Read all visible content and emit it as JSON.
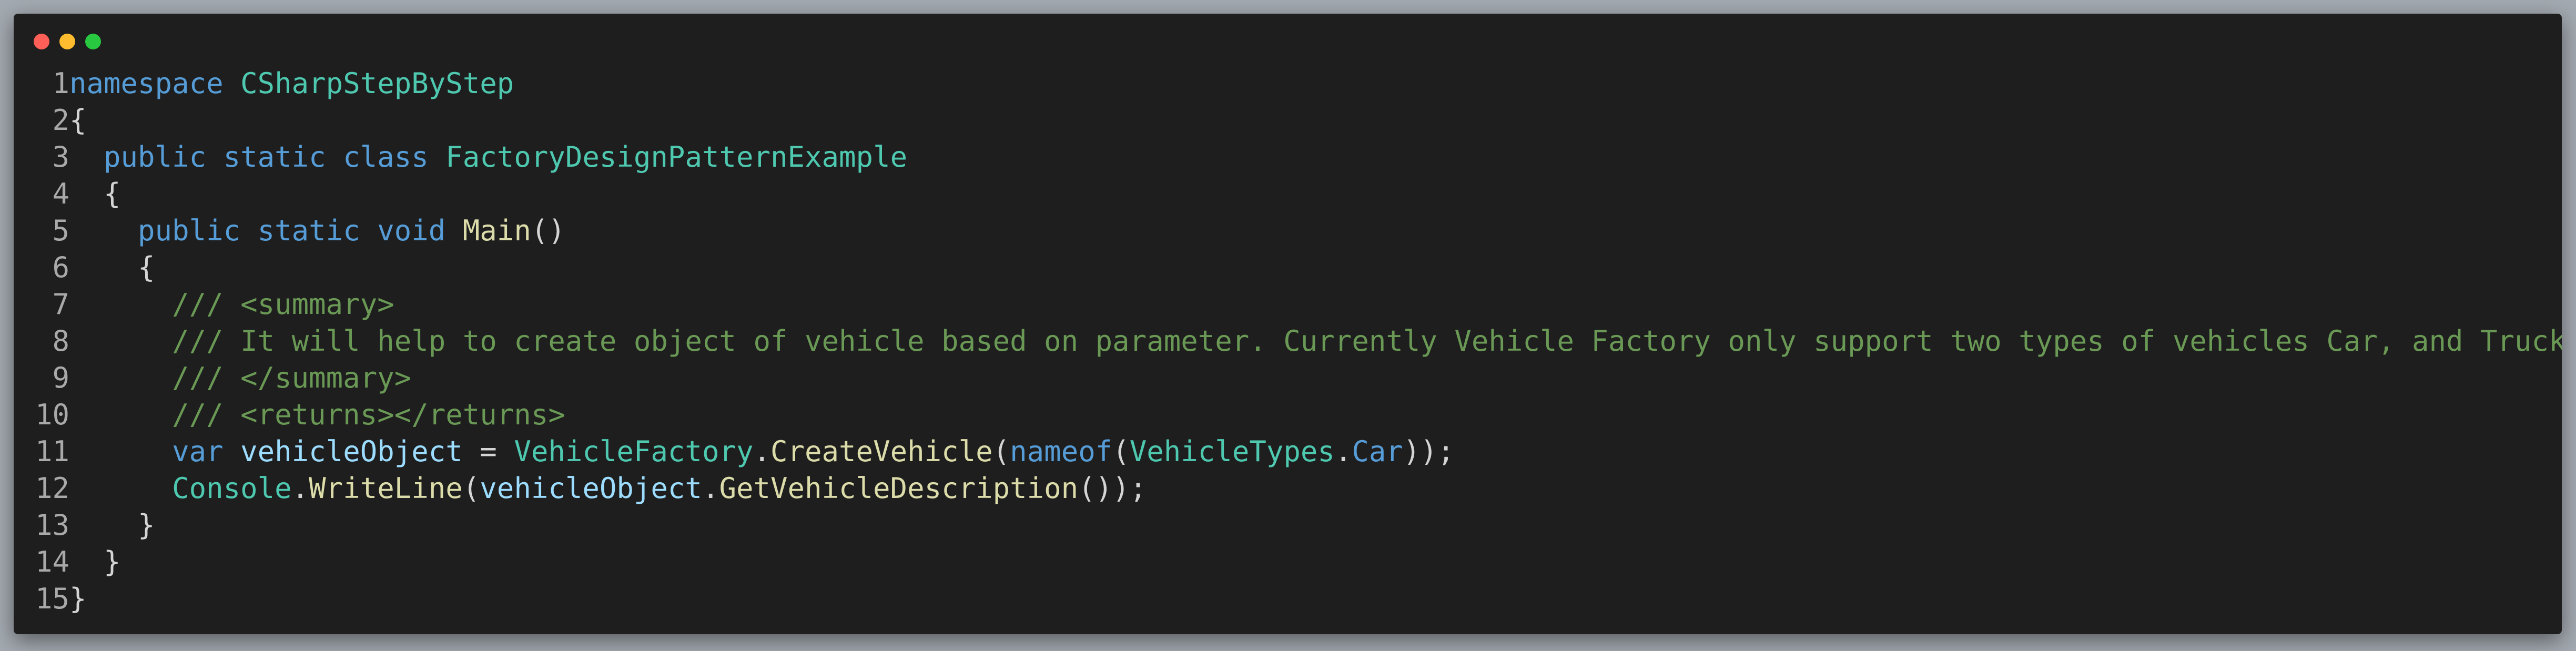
{
  "window": {
    "controls": [
      {
        "name": "close",
        "color": "#ff5f57"
      },
      {
        "name": "minimize",
        "color": "#febc2e"
      },
      {
        "name": "maximize",
        "color": "#28c840"
      }
    ]
  },
  "colors": {
    "keyword": "#569cd6",
    "type": "#4ec9b0",
    "method": "#dcdcaa",
    "variable": "#9cdcfe",
    "comment": "#6a9955",
    "plain": "#d4d4d4",
    "line_number": "#a9a9a9",
    "background": "#1e1e1e"
  },
  "code": {
    "language": "C#",
    "lines": [
      {
        "number": "1",
        "tokens": [
          {
            "t": "namespace",
            "c": "keyword"
          },
          {
            "t": " ",
            "c": "plain"
          },
          {
            "t": "CSharpStepByStep",
            "c": "type"
          }
        ]
      },
      {
        "number": "2",
        "tokens": [
          {
            "t": "{",
            "c": "plain"
          }
        ]
      },
      {
        "number": "3",
        "tokens": [
          {
            "t": "  ",
            "c": "plain"
          },
          {
            "t": "public",
            "c": "keyword"
          },
          {
            "t": " ",
            "c": "plain"
          },
          {
            "t": "static",
            "c": "keyword"
          },
          {
            "t": " ",
            "c": "plain"
          },
          {
            "t": "class",
            "c": "keyword"
          },
          {
            "t": " ",
            "c": "plain"
          },
          {
            "t": "FactoryDesignPatternExample",
            "c": "type"
          }
        ]
      },
      {
        "number": "4",
        "tokens": [
          {
            "t": "  {",
            "c": "plain"
          }
        ]
      },
      {
        "number": "5",
        "tokens": [
          {
            "t": "    ",
            "c": "plain"
          },
          {
            "t": "public",
            "c": "keyword"
          },
          {
            "t": " ",
            "c": "plain"
          },
          {
            "t": "static",
            "c": "keyword"
          },
          {
            "t": " ",
            "c": "plain"
          },
          {
            "t": "void",
            "c": "keyword"
          },
          {
            "t": " ",
            "c": "plain"
          },
          {
            "t": "Main",
            "c": "method"
          },
          {
            "t": "()",
            "c": "plain"
          }
        ]
      },
      {
        "number": "6",
        "tokens": [
          {
            "t": "    {",
            "c": "plain"
          }
        ]
      },
      {
        "number": "7",
        "tokens": [
          {
            "t": "      ",
            "c": "plain"
          },
          {
            "t": "/// <summary>",
            "c": "comment"
          }
        ]
      },
      {
        "number": "8",
        "tokens": [
          {
            "t": "      ",
            "c": "plain"
          },
          {
            "t": "/// It will help to create object of vehicle based on parameter. Currently Vehicle Factory only support two types of vehicles Car, and Truck",
            "c": "comment"
          }
        ]
      },
      {
        "number": "9",
        "tokens": [
          {
            "t": "      ",
            "c": "plain"
          },
          {
            "t": "/// </summary>",
            "c": "comment"
          }
        ]
      },
      {
        "number": "10",
        "tokens": [
          {
            "t": "      ",
            "c": "plain"
          },
          {
            "t": "/// <returns></returns>",
            "c": "comment"
          }
        ]
      },
      {
        "number": "11",
        "tokens": [
          {
            "t": "      ",
            "c": "plain"
          },
          {
            "t": "var",
            "c": "keyword"
          },
          {
            "t": " ",
            "c": "plain"
          },
          {
            "t": "vehicleObject",
            "c": "variable"
          },
          {
            "t": " = ",
            "c": "plain"
          },
          {
            "t": "VehicleFactory",
            "c": "type"
          },
          {
            "t": ".",
            "c": "plain"
          },
          {
            "t": "CreateVehicle",
            "c": "method"
          },
          {
            "t": "(",
            "c": "plain"
          },
          {
            "t": "nameof",
            "c": "keyword"
          },
          {
            "t": "(",
            "c": "plain"
          },
          {
            "t": "VehicleTypes",
            "c": "type"
          },
          {
            "t": ".",
            "c": "plain"
          },
          {
            "t": "Car",
            "c": "keyword"
          },
          {
            "t": "));",
            "c": "plain"
          }
        ]
      },
      {
        "number": "12",
        "tokens": [
          {
            "t": "      ",
            "c": "plain"
          },
          {
            "t": "Console",
            "c": "type"
          },
          {
            "t": ".",
            "c": "plain"
          },
          {
            "t": "WriteLine",
            "c": "method"
          },
          {
            "t": "(",
            "c": "plain"
          },
          {
            "t": "vehicleObject",
            "c": "variable"
          },
          {
            "t": ".",
            "c": "plain"
          },
          {
            "t": "GetVehicleDescription",
            "c": "method"
          },
          {
            "t": "());",
            "c": "plain"
          }
        ]
      },
      {
        "number": "13",
        "tokens": [
          {
            "t": "    }",
            "c": "plain"
          }
        ]
      },
      {
        "number": "14",
        "tokens": [
          {
            "t": "  }",
            "c": "plain"
          }
        ]
      },
      {
        "number": "15",
        "tokens": [
          {
            "t": "}",
            "c": "plain"
          }
        ]
      }
    ]
  }
}
